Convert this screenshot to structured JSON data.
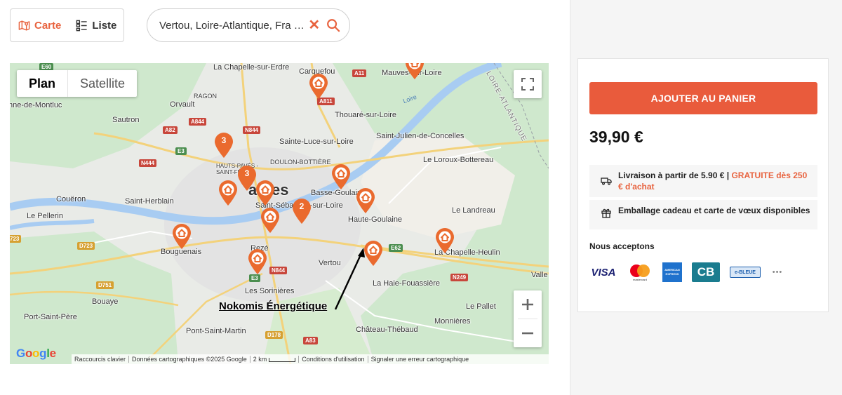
{
  "view_toggle": {
    "map_label": "Carte",
    "list_label": "Liste"
  },
  "search": {
    "value": "Vertou, Loire-Atlantique, Fra …",
    "placeholder": ""
  },
  "map": {
    "type_plan": "Plan",
    "type_satellite": "Satellite",
    "annotation": "Nokomis Énergétique",
    "places": [
      {
        "name": "La Chapelle-sur-Erdre"
      },
      {
        "name": "Carquefou"
      },
      {
        "name": "Mauves-sur-Loire"
      },
      {
        "name": "nne-de-Montluc"
      },
      {
        "name": "RAGON"
      },
      {
        "name": "Orvault"
      },
      {
        "name": "Thouaré-sur-Loire"
      },
      {
        "name": "Sautron"
      },
      {
        "name": "Sainte-Luce-sur-Loire"
      },
      {
        "name": "Saint-Julien-de-Concelles"
      },
      {
        "name": "DOULON-BOTTIÈRE"
      },
      {
        "name": "Le Loroux-Bottereau"
      },
      {
        "name": "HAUTS-PAVÉS - SAINT-FÉLIX"
      },
      {
        "name": "antes"
      },
      {
        "name": "Basse-Goulaine"
      },
      {
        "name": "Couëron"
      },
      {
        "name": "Saint-Herblain"
      },
      {
        "name": "Saint-Sébastien-sur-Loire"
      },
      {
        "name": "Le Landreau"
      },
      {
        "name": "Le Pellerin"
      },
      {
        "name": "Haute-Goulaine"
      },
      {
        "name": "Bouguenais"
      },
      {
        "name": "Rezé"
      },
      {
        "name": "La Chapelle-Heulin"
      },
      {
        "name": "Vertou"
      },
      {
        "name": "La Haie-Fouassière"
      },
      {
        "name": "Valle"
      },
      {
        "name": "Bouaye"
      },
      {
        "name": "Les Sorinières"
      },
      {
        "name": "Le Pallet"
      },
      {
        "name": "Port-Saint-Père"
      },
      {
        "name": "Monnières"
      },
      {
        "name": "Château-Thébaud"
      },
      {
        "name": "Pont-Saint-Martin"
      },
      {
        "name": "LOIRE-ATLANTIQUE"
      },
      {
        "name": "Loire"
      }
    ],
    "roads": [
      "E60",
      "A11",
      "A844",
      "A82",
      "N844",
      "A811",
      "E3",
      "N444",
      "D723",
      "E62",
      "N249",
      "D751",
      "D178",
      "A83",
      "723"
    ],
    "clusters": [
      {
        "count": "3"
      },
      {
        "count": "3"
      },
      {
        "count": "2"
      }
    ],
    "footer": {
      "shortcuts": "Raccourcis clavier",
      "data": "Données cartographiques ©2025 Google",
      "scale": "2 km",
      "terms": "Conditions d'utilisation",
      "report": "Signaler une erreur cartographique"
    },
    "google_logo": [
      "G",
      "o",
      "o",
      "g",
      "l",
      "e"
    ]
  },
  "cart": {
    "add_button": "AJOUTER AU PANIER",
    "price": "39,90 €",
    "delivery_text": "Livraison à partir de 5.90 € | ",
    "delivery_free": "GRATUITE dès 250 € d'achat",
    "gift_text": "Emballage cadeau et carte de vœux disponibles",
    "accept_title": "Nous acceptons",
    "payments": {
      "visa": "VISA",
      "mastercard": "mastercard",
      "amex": "AMERICAN EXPRESS",
      "cb": "CB",
      "ebleue": "e-BLEUE",
      "more": "•••"
    }
  },
  "colors": {
    "accent": "#e8633f",
    "button": "#e95b3c",
    "marker": "#ea6a2e"
  }
}
